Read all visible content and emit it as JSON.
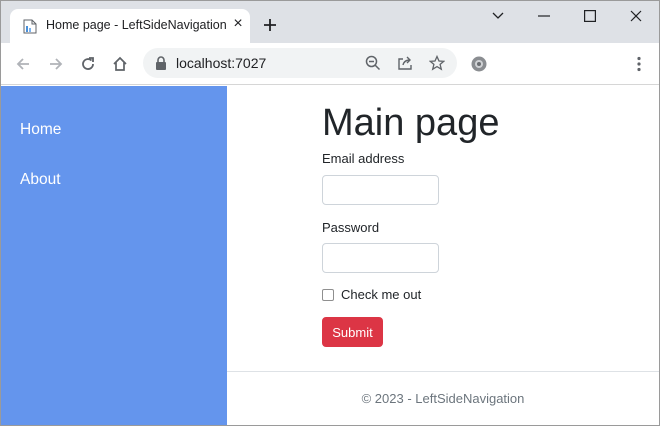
{
  "browser": {
    "tab_title": "Home page - LeftSideNavigation",
    "tab_close_glyph": "×",
    "url": "localhost:7027"
  },
  "sidebar": {
    "items": [
      {
        "label": "Home"
      },
      {
        "label": "About"
      }
    ]
  },
  "main": {
    "title": "Main page",
    "email_label": "Email address",
    "email_value": "",
    "password_label": "Password",
    "password_value": "",
    "check_label": "Check me out",
    "check_checked": false,
    "submit_label": "Submit"
  },
  "footer": {
    "text": "© 2023 - LeftSideNavigation"
  },
  "colors": {
    "sidebar": "#6495ed",
    "submit": "#dc3545",
    "tabstrip": "#dee1e6"
  }
}
